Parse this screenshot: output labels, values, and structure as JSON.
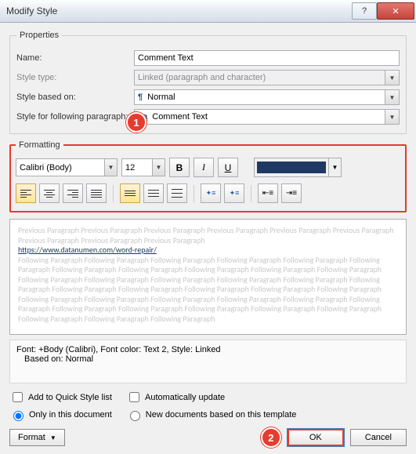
{
  "title": "Modify Style",
  "callouts": {
    "c1": "1",
    "c2": "2"
  },
  "properties": {
    "legend": "Properties",
    "name_label": "Name:",
    "name_value": "Comment Text",
    "styletype_label": "Style type:",
    "styletype_value": "Linked (paragraph and character)",
    "basedon_label": "Style based on:",
    "basedon_value": "Normal",
    "following_label": "Style for following paragraph:",
    "following_value": "Comment Text"
  },
  "formatting": {
    "legend": "Formatting",
    "font": "Calibri (Body)",
    "size": "12",
    "bold": "B",
    "italic": "I",
    "underline": "U",
    "color_hex": "#1f3864"
  },
  "preview": {
    "prev_para": "Previous Paragraph Previous Paragraph Previous Paragraph Previous Paragraph Previous Paragraph Previous Paragraph Previous Paragraph Previous Paragraph Previous Paragraph",
    "link": "https://www.datanumen.com/word-repair/",
    "foll_para": "Following Paragraph Following Paragraph Following Paragraph Following Paragraph Following Paragraph Following Paragraph Following Paragraph Following Paragraph Following Paragraph Following Paragraph Following Paragraph Following Paragraph Following Paragraph Following Paragraph Following Paragraph Following Paragraph Following Paragraph Following Paragraph Following Paragraph Following Paragraph Following Paragraph Following Paragraph Following Paragraph Following Paragraph Following Paragraph Following Paragraph Following Paragraph Following Paragraph Following Paragraph Following Paragraph Following Paragraph Following Paragraph Following Paragraph Following Paragraph Following Paragraph Following Paragraph"
  },
  "description": {
    "line1": "Font: +Body (Calibri), Font color: Text 2, Style: Linked",
    "line2": "Based on: Normal"
  },
  "options": {
    "quick_style": "Add to Quick Style list",
    "auto_update": "Automatically update",
    "only_doc": "Only in this document",
    "new_docs": "New documents based on this template"
  },
  "buttons": {
    "format": "Format",
    "ok": "OK",
    "cancel": "Cancel"
  }
}
